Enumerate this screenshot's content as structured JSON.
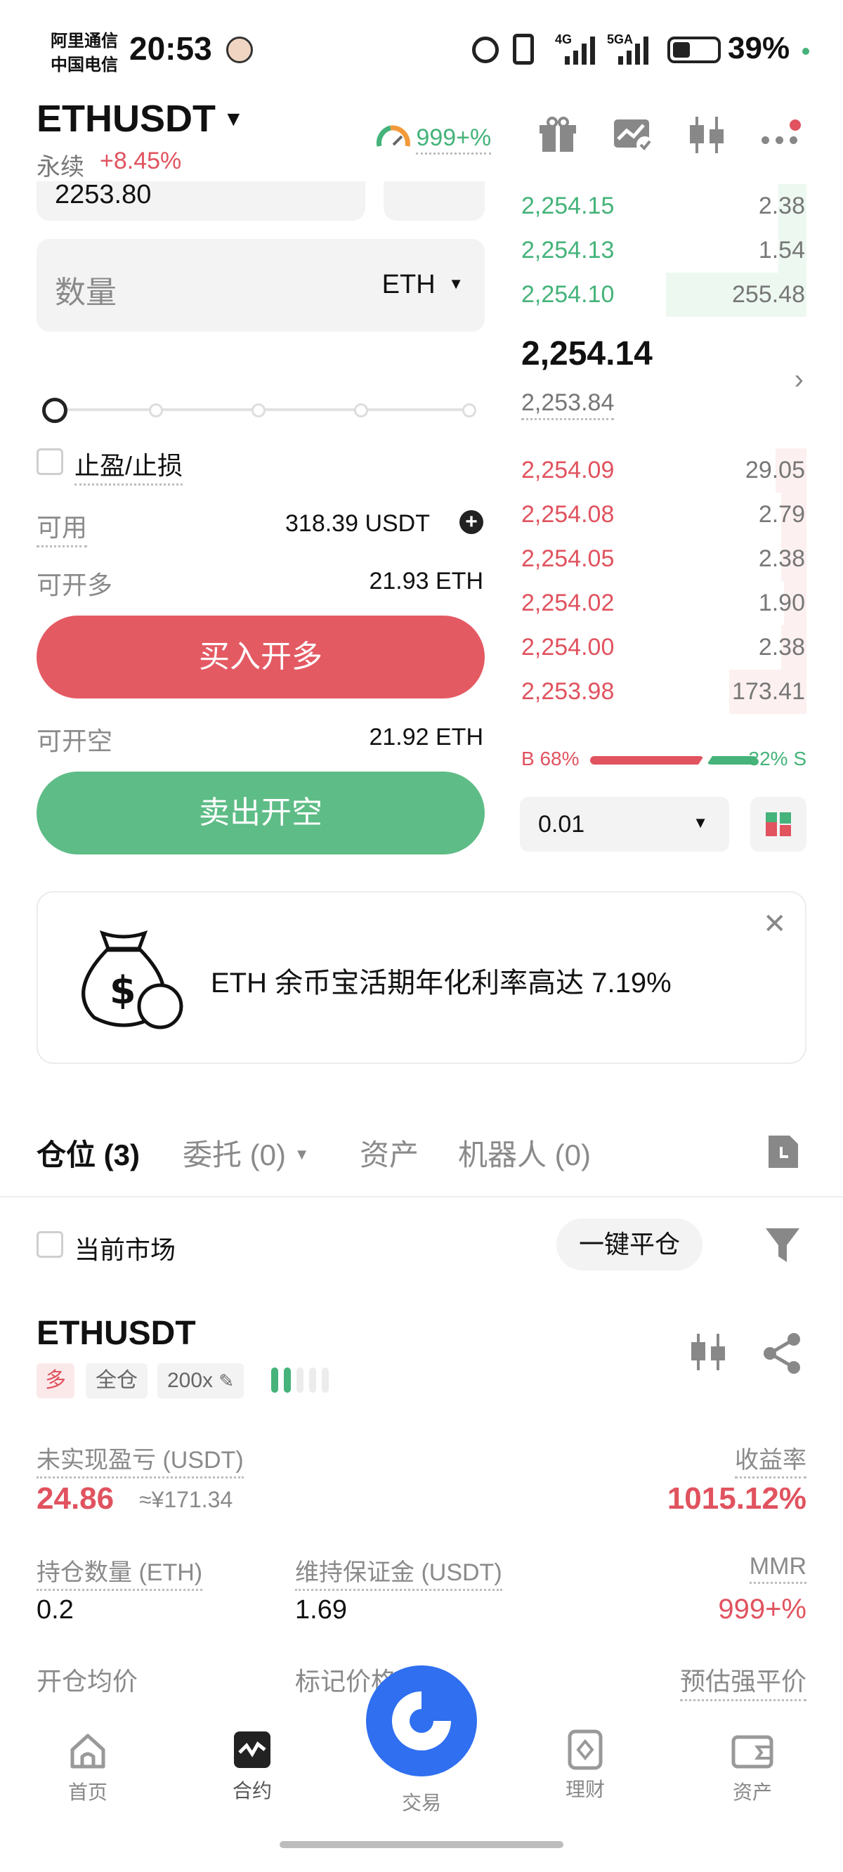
{
  "status_bar": {
    "carrier1": "阿里通信",
    "carrier2": "中国电信",
    "time": "20:53",
    "net1": "4G",
    "net2": "5GA",
    "battery": "39%"
  },
  "header": {
    "pair": "ETHUSDT",
    "perp": "永续",
    "change": "+8.45%",
    "gauge_value": "999+%"
  },
  "order_form": {
    "price_value": "2253.80",
    "qty_placeholder": "数量",
    "qty_unit": "ETH",
    "tpsl_label": "止盈/止损",
    "avail_label": "可用",
    "avail_value": "318.39 USDT",
    "can_long_label": "可开多",
    "can_long_value": "21.93 ETH",
    "buy_button": "买入开多",
    "can_short_label": "可开空",
    "can_short_value": "21.92 ETH",
    "sell_button": "卖出开空",
    "slider_progress": 0
  },
  "orderbook": {
    "asks": [
      {
        "price": "2,254.15",
        "qty": "2.38",
        "depth": 0.2
      },
      {
        "price": "2,254.13",
        "qty": "1.54",
        "depth": 0.2
      },
      {
        "price": "2,254.10",
        "qty": "255.48",
        "depth": 1.0
      }
    ],
    "last_price": "2,254.14",
    "mark_price": "2,253.84",
    "bids": [
      {
        "price": "2,254.09",
        "qty": "29.05",
        "depth": 0.22
      },
      {
        "price": "2,254.08",
        "qty": "2.79",
        "depth": 0.18
      },
      {
        "price": "2,254.05",
        "qty": "2.38",
        "depth": 0.18
      },
      {
        "price": "2,254.02",
        "qty": "1.90",
        "depth": 0.16
      },
      {
        "price": "2,254.00",
        "qty": "2.38",
        "depth": 0.18
      },
      {
        "price": "2,253.98",
        "qty": "173.41",
        "depth": 0.55
      }
    ],
    "buy_ratio_label": "B 68%",
    "sell_ratio_label": "32% S",
    "buy_ratio": 0.68,
    "precision": "0.01"
  },
  "banner": {
    "text": "ETH 余币宝活期年化利率高达 7.19%"
  },
  "tabs": {
    "positions": "仓位 (3)",
    "orders": "委托 (0)",
    "assets": "资产",
    "bots": "机器人 (0)"
  },
  "filter": {
    "current_market": "当前市场",
    "close_all": "一键平仓"
  },
  "position": {
    "symbol": "ETHUSDT",
    "side": "多",
    "margin_mode": "全仓",
    "leverage": "200x",
    "upnl_label": "未实现盈亏 (USDT)",
    "upnl_value": "24.86",
    "upnl_cny": "≈¥171.34",
    "roe_label": "收益率",
    "roe_value": "1015.12%",
    "size_label": "持仓数量 (ETH)",
    "size_value": "0.2",
    "maint_label": "维持保证金 (USDT)",
    "maint_value": "1.69",
    "mmr_label": "MMR",
    "mmr_value": "999+%",
    "entry_label": "开仓均价",
    "mark_label": "标记价格",
    "liq_label": "预估强平价"
  },
  "bottom_nav": {
    "home": "首页",
    "futures": "合约",
    "trade": "交易",
    "earn": "理财",
    "assets": "资产"
  },
  "colors": {
    "green": "#45b37a",
    "red": "#e0535f",
    "blue": "#2f6ff0"
  }
}
